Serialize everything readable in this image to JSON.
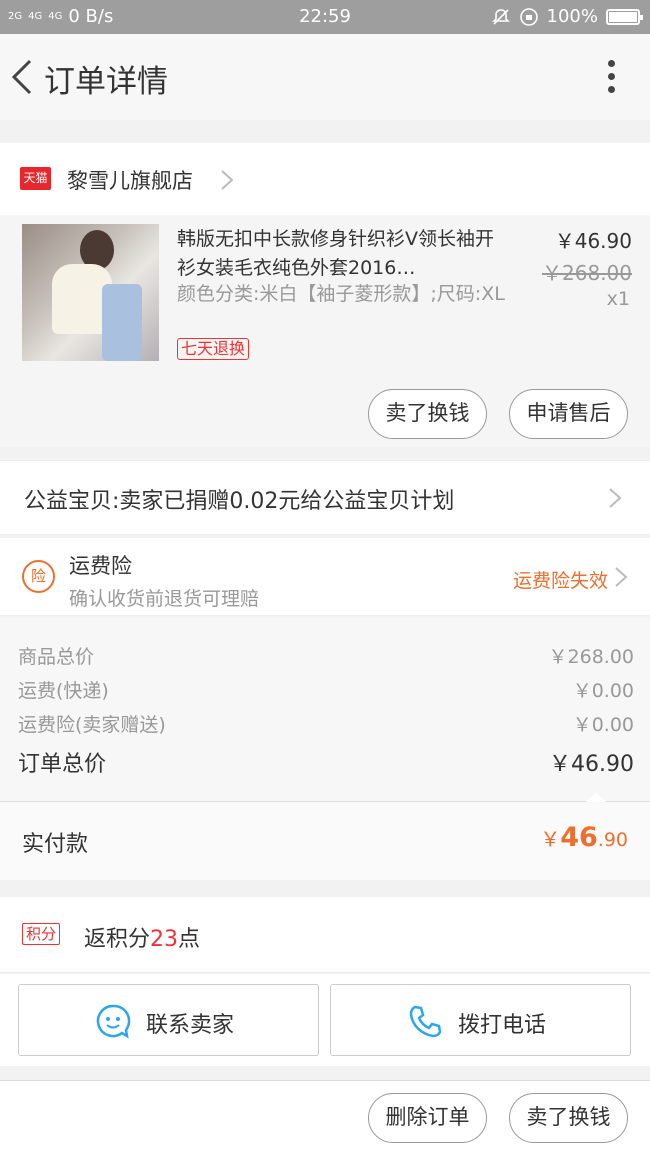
{
  "status_bar": {
    "network_left": "2G",
    "network_mid": "4G",
    "network_right": "4G",
    "speed": "0 B/s",
    "time": "22:59",
    "battery": "100%"
  },
  "navbar": {
    "title": "订单详情"
  },
  "shop": {
    "logo_text": "天猫",
    "name": "黎雪儿旗舰店"
  },
  "product": {
    "title": "韩版无扣中长款修身针织衫V领长袖开衫女装毛衣纯色外套2016…",
    "spec": "颜色分类:米白【袖子菱形款】;尺码:XL",
    "badge": "七天退换",
    "price": "￥46.90",
    "original_price": "￥268.00",
    "quantity": "x1",
    "sell_label": "卖了换钱",
    "aftersale_label": "申请售后"
  },
  "charity": {
    "text": "公益宝贝:卖家已捐赠0.02元给公益宝贝计划"
  },
  "insurance": {
    "icon_text": "险",
    "title": "运费险",
    "subtitle": "确认收货前退货可理赔",
    "status": "运费险失效"
  },
  "summary": {
    "rows": [
      {
        "label": "商品总价",
        "value": "￥268.00"
      },
      {
        "label": "运费(快递)",
        "value": "￥0.00"
      },
      {
        "label": "运费险(卖家赠送)",
        "value": "￥0.00"
      }
    ],
    "total_label": "订单总价",
    "total_value": "￥46.90"
  },
  "paid": {
    "label": "实付款",
    "currency": "￥",
    "integer": "46",
    "decimal": ".90"
  },
  "points": {
    "tag": "积分",
    "prefix": "返积分",
    "count": "23",
    "suffix": "点"
  },
  "contact": {
    "seller_label": "联系卖家",
    "phone_label": "拨打电话"
  },
  "bottom": {
    "delete_label": "删除订单",
    "sell_label": "卖了换钱"
  },
  "colors": {
    "accent_orange": "#ee6f2d",
    "tmall_red": "#e8262c",
    "contact_blue": "#2aa6f1"
  }
}
